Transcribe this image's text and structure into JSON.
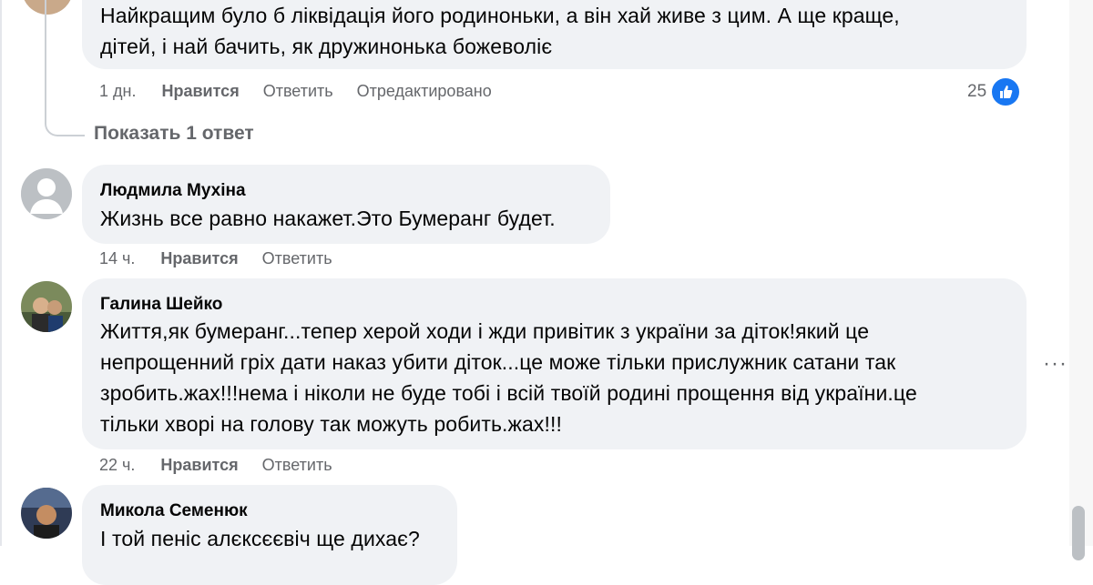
{
  "comments": [
    {
      "text": "Найкращим було б ліквідація його родиноньки, а він хай живе з цим. А ще краще,\nдітей, і най бачить, як дружинонька божеволіє",
      "time": "1 дн.",
      "like_label": "Нравится",
      "reply_label": "Ответить",
      "edited_label": "Отредактировано",
      "reaction_count": "25",
      "show_replies": "Показать 1 ответ"
    },
    {
      "author": "Людмила Мухіна",
      "text": "Жизнь все равно накажет.Это Бумеранг будет.",
      "time": "14 ч.",
      "like_label": "Нравится",
      "reply_label": "Ответить"
    },
    {
      "author": "Галина Шейко",
      "text": "Життя,як бумеранг...тепер херой ходи і жди привітик з україни за діток!який це\nнепрощенний гріх дати наказ убити діток...це може тільки прислужник сатани так\nзробить.жах!!!нема і ніколи не буде тобі і всій твоїй родині прощення від україни.це\nтільки хворі на голову так можуть робить.жах!!!",
      "time": "22 ч.",
      "like_label": "Нравится",
      "reply_label": "Ответить",
      "more_label": "···"
    },
    {
      "author": "Микола Семенюк",
      "text": "І той пеніс алєксєєвіч ще дихає?"
    }
  ],
  "icons": {
    "like_badge": "thumbs-up-icon",
    "more": "more-options-icon"
  },
  "colors": {
    "bubble": "#f0f2f5",
    "like_blue": "#1877f2",
    "meta_gray": "#65676b"
  }
}
